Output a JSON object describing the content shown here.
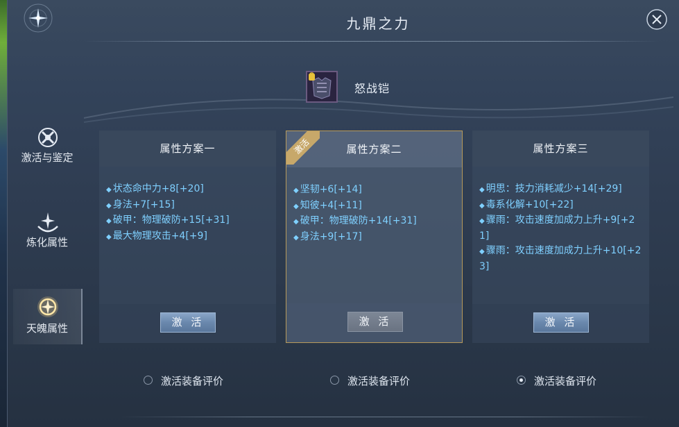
{
  "window": {
    "title": "九鼎之力"
  },
  "sidebar": {
    "items": [
      {
        "label": "激活与鉴定",
        "icon": "sword-shield-icon"
      },
      {
        "label": "炼化属性",
        "icon": "sparkle-wave-icon"
      },
      {
        "label": "天魄属性",
        "icon": "glowing-orb-icon",
        "active": true
      }
    ]
  },
  "item": {
    "name": "怒战铠",
    "icon": "armor-icon"
  },
  "panels": [
    {
      "title": "属性方案一",
      "attrs": [
        "状态命中力+8[+20]",
        "身法+7[+15]",
        "破甲：物理破防+15[+31]",
        "最大物理攻击+4[+9]"
      ],
      "button": "激 活"
    },
    {
      "title": "属性方案二",
      "badge": "激活",
      "attrs": [
        "坚韧+6[+14]",
        "知彼+4[+11]",
        "破甲：物理破防+14[+31]",
        "身法+9[+17]"
      ],
      "button": "激 活"
    },
    {
      "title": "属性方案三",
      "attrs": [
        "明思：技力消耗减少+14[+29]",
        "毒系化解+10[+22]",
        "骤雨：攻击速度加成力上升+9[+21]",
        "骤雨：攻击速度加成力上升+10[+23]"
      ],
      "button": "激 活"
    }
  ],
  "radios": [
    {
      "label": "激活装备评价",
      "checked": false
    },
    {
      "label": "激活装备评价",
      "checked": false
    },
    {
      "label": "激活装备评价",
      "checked": true
    }
  ],
  "colors": {
    "attr_text": "#7fd0ff",
    "active_border": "#c7a86a",
    "button": "#6a88ad"
  }
}
